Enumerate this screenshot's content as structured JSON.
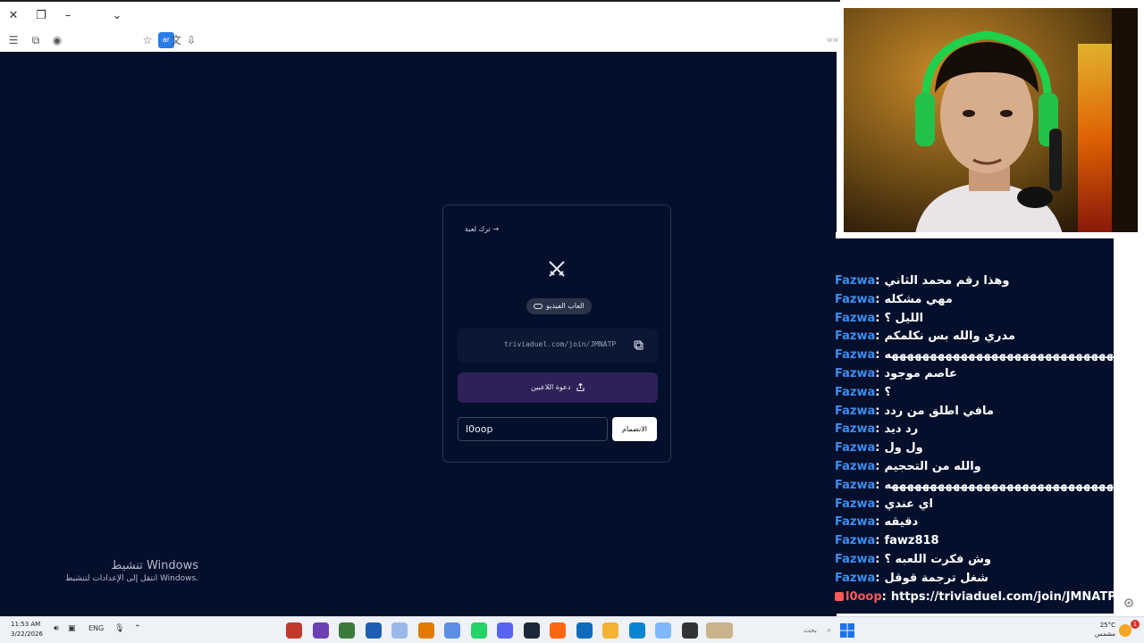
{
  "colors": {
    "page_bg": "#030f2b",
    "card_border": "#2b3550",
    "invite_button": "#2d2157",
    "chat_username": "#3d8ef0",
    "chat_self_username": "#ff5a5a",
    "taskbar_bg": "#eef1f6"
  },
  "browser": {
    "url_tail": "ww",
    "window_icons": [
      "close-icon",
      "restore-icon",
      "minimize-icon",
      "chevron-down-icon"
    ],
    "toolbar_icons": [
      "menu-icon",
      "extensions-icon",
      "badge-icon",
      "star-icon",
      "translate-icon",
      "download-icon"
    ],
    "translate_label": "ar"
  },
  "card": {
    "leave_label": "ترك لعبة →",
    "badge_label": "العاب الفيديو",
    "invite_link": "triviaduel.com/join/JMNATP",
    "invite_button_label": "دعوة اللاعبين",
    "name_value": "l0oop",
    "join_button_label": "الانضمام"
  },
  "activation": {
    "title": "تنشيط Windows",
    "subtitle": "انتقل إلى الإعدادات لتنشيط Windows."
  },
  "chat": {
    "messages": [
      {
        "user": "Fazwa",
        "text": "وهذا رقم محمد الثاني"
      },
      {
        "user": "Fazwa",
        "text": "مهي مشكله"
      },
      {
        "user": "Fazwa",
        "text": "الليل ؟"
      },
      {
        "user": "Fazwa",
        "text": "مدري والله بس نكلمكم"
      },
      {
        "user": "Fazwa",
        "text": "ههههههههههههههههههههههههههههههههههههههههههههههههه"
      },
      {
        "user": "Fazwa",
        "text": "عاصم موجود"
      },
      {
        "user": "Fazwa",
        "text": "؟"
      },
      {
        "user": "Fazwa",
        "text": "مافي اطلق من ردد"
      },
      {
        "user": "Fazwa",
        "text": "رد ديد"
      },
      {
        "user": "Fazwa",
        "text": "ول ول"
      },
      {
        "user": "Fazwa",
        "text": "والله من التحجيم"
      },
      {
        "user": "Fazwa",
        "text": "ههههههههههههههههههههههههههههههههههههههههههههههههه"
      },
      {
        "user": "Fazwa",
        "text": "اي عندي"
      },
      {
        "user": "Fazwa",
        "text": "دقيقه"
      },
      {
        "user": "Fazwa",
        "text": "fawz818"
      },
      {
        "user": "Fazwa",
        "text": "وش فكرت اللعبه ؟"
      },
      {
        "user": "Fazwa",
        "text": "شغل ترجمة قوقل"
      },
      {
        "user": "l0oop",
        "text": "https://triviaduel.com/join/JMNATP",
        "self": true
      }
    ]
  },
  "taskbar": {
    "time": "11:53 AM",
    "date": "3/22/2026",
    "language": "ENG",
    "search_placeholder": "بحث",
    "temperature": "25°C",
    "weather_text": "مشمس",
    "notification_count": "1",
    "apps": [
      "app-icon-1",
      "app-icon-2",
      "app-icon-3",
      "photoshop-icon",
      "app-icon-5",
      "app-icon-6",
      "app-icon-7",
      "whatsapp-icon",
      "discord-icon",
      "steam-icon",
      "firefox-icon",
      "store-icon",
      "folder-icon",
      "edge-icon",
      "copilot-icon",
      "app-icon-16"
    ],
    "app_colors": [
      "#c0392b",
      "#6c3fb3",
      "#3b7a3b",
      "#1e5fb3",
      "#9bb8e8",
      "#e07b00",
      "#5c8ee6",
      "#25d366",
      "#5865f2",
      "#1b2838",
      "#ff6611",
      "#0f6cbd",
      "#f2b233",
      "#0a84d0",
      "#7fb8ff",
      "#333333"
    ]
  }
}
